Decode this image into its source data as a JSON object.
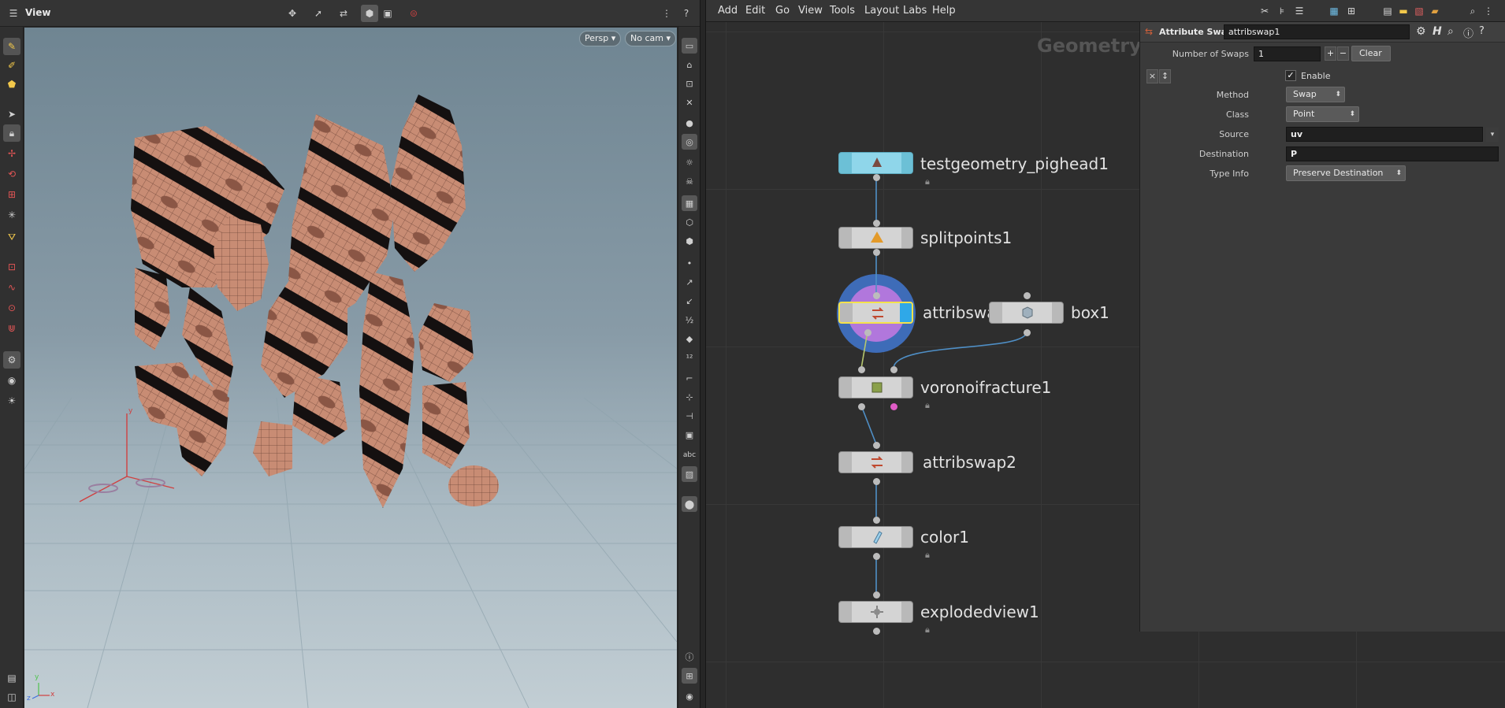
{
  "viewport": {
    "pane_title": "View",
    "camera_menu": "Persp",
    "cam_menu": "No cam",
    "axis_labels": {
      "x": "x",
      "y": "y",
      "z": "z"
    }
  },
  "network": {
    "menu": [
      "Add",
      "Edit",
      "Go",
      "View",
      "Tools",
      "Layout",
      "Labs",
      "Help"
    ],
    "context_title": "Geometry",
    "nodes": [
      {
        "name": "testgeometry_pighead1",
        "color": "#8fd6ea",
        "locked": true
      },
      {
        "name": "splitpoints1",
        "color": "#d4d4d4",
        "locked": false
      },
      {
        "name": "attribswa",
        "color": "#d4d4d4",
        "selected": true,
        "display_flag": true,
        "locked": false
      },
      {
        "name": "box1",
        "color": "#d4d4d4",
        "locked": false
      },
      {
        "name": "voronoifracture1",
        "color": "#d4d4d4",
        "locked": true
      },
      {
        "name": "attribswap2",
        "color": "#d4d4d4",
        "locked": false
      },
      {
        "name": "color1",
        "color": "#d4d4d4",
        "locked": true
      },
      {
        "name": "explodedview1",
        "color": "#d4d4d4",
        "locked": true
      }
    ]
  },
  "params": {
    "node_type": "Attribute Swap",
    "node_name": "attribswap1",
    "num_swaps_label": "Number of Swaps",
    "num_swaps_value": "1",
    "clear_label": "Clear",
    "enable_label": "Enable",
    "enable_checked": true,
    "method_label": "Method",
    "method_value": "Swap",
    "class_label": "Class",
    "class_value": "Point",
    "source_label": "Source",
    "source_value": "uv",
    "destination_label": "Destination",
    "destination_value": "P",
    "typeinfo_label": "Type Info",
    "typeinfo_value": "Preserve Destination"
  },
  "colors": {
    "accent_yellow": "#f2c84b",
    "display_flag_blue": "#2fa8e8",
    "selection_ring": "#9d6fd8",
    "wire": "#4f8fc6"
  }
}
